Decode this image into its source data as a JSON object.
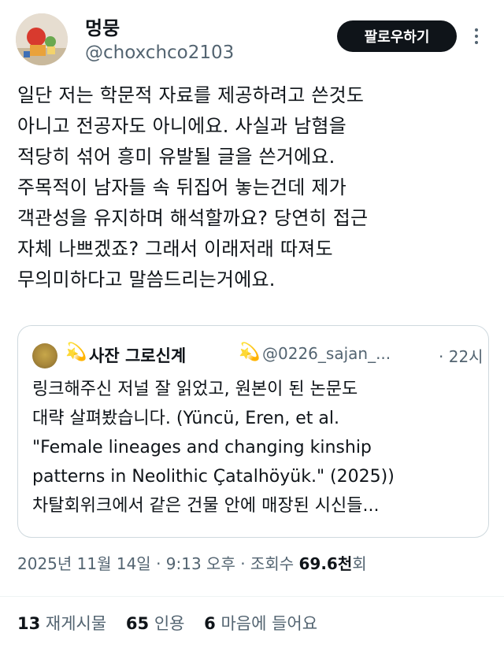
{
  "author": {
    "name": "멍뭉",
    "handle": "@choxchco2103",
    "follow_label": "팔로우하기"
  },
  "tweet": {
    "lines": [
      "일단 저는 학문적 자료를 제공하려고 쓴것도",
      "아니고 전공자도 아니에요. 사실과 남혐을",
      "적당히 섞어 흥미 유발될 글을 쓴거에요.",
      "주목적이 남자들 속 뒤집어 놓는건데 제가",
      "객관성을 유지하며 해석할까요? 당연히 접근",
      "자체 나쁘겠죠? 그래서 이래저래 따져도",
      "무의미하다고 말씀드리는거에요."
    ]
  },
  "quote": {
    "star_left": "💫",
    "name": "사잔 그로신계",
    "star_right": "💫",
    "handle": "@0226_sajan_...",
    "time": "· 22시",
    "lines": [
      "링크해주신 저널 잘 읽었고, 원본이 된 논문도",
      "대략 살펴봤습니다. (Yüncü, Eren, et al.",
      "\"Female lineages and changing kinship",
      "patterns in Neolithic Çatalhöyük.\" (2025))",
      "차탈회위크에서 같은 건물 안에 매장된 시신들..."
    ]
  },
  "meta": {
    "datetime": "2025년 11월 14일 · 9:13 오후 · 조회수",
    "views": "69.6천",
    "views_suffix": "회"
  },
  "stats": {
    "retweets_count": "13",
    "retweets_label": "재게시물",
    "quotes_count": "65",
    "quotes_label": "인용",
    "likes_count": "6",
    "likes_label": "마음에 들어요"
  }
}
